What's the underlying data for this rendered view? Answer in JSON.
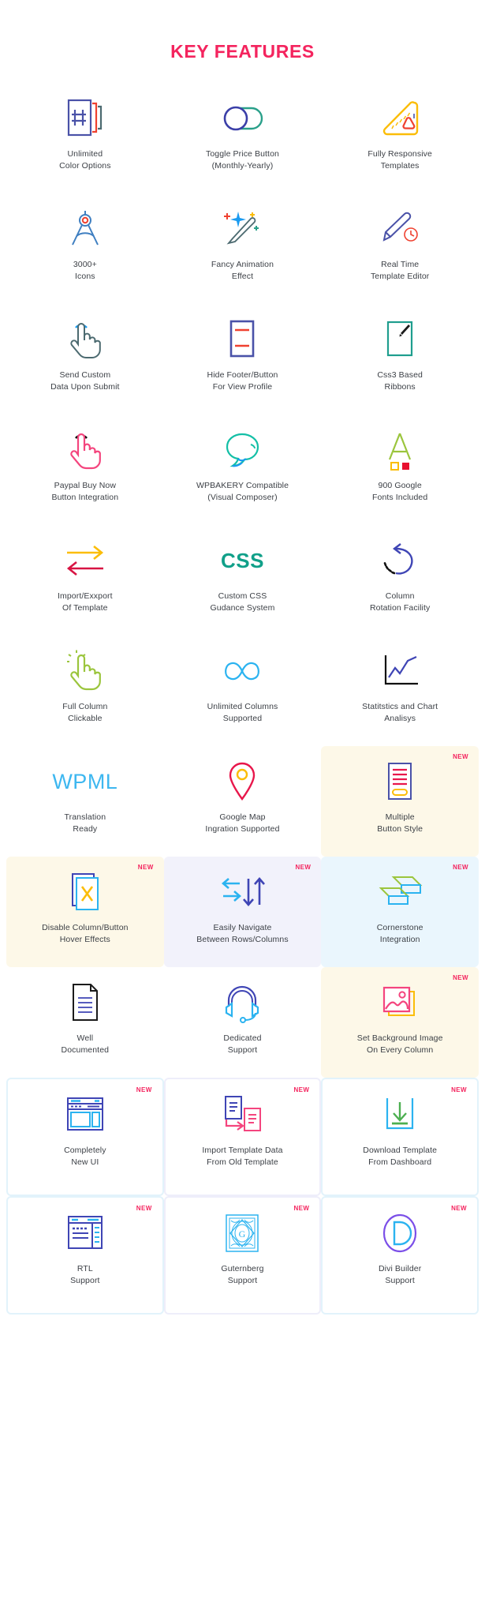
{
  "header": {
    "title": "KEY FEATURES",
    "title_color": "#f4245e"
  },
  "badges": {
    "new": "NEW",
    "new_color": "#f4245e"
  },
  "features": [
    {
      "id": "unlimited-color-options",
      "label": "Unlimited\nColor Options",
      "icon": "color-swatch-hash-icon",
      "badge": null,
      "bg": "none"
    },
    {
      "id": "toggle-price-button",
      "label": "Toggle Price Button\n(Monthly-Yearly)",
      "icon": "toggle-switch-icon",
      "badge": null,
      "bg": "none"
    },
    {
      "id": "fully-responsive-templates",
      "label": "Fully Responsive\nTemplates",
      "icon": "ruler-triangle-icon",
      "badge": null,
      "bg": "none"
    },
    {
      "id": "3000-icons",
      "label": "3000+\nIcons",
      "icon": "compass-divider-icon",
      "badge": null,
      "bg": "none"
    },
    {
      "id": "fancy-animation-effect",
      "label": "Fancy Animation\nEffect",
      "icon": "magic-wand-sparkle-icon",
      "badge": null,
      "bg": "none"
    },
    {
      "id": "real-time-template-editor",
      "label": "Real Time\nTemplate Editor",
      "icon": "pencil-clock-icon",
      "badge": null,
      "bg": "none"
    },
    {
      "id": "send-custom-data",
      "label": "Send  Custom\nData Upon Submit",
      "icon": "click-hand-icon",
      "badge": null,
      "bg": "none"
    },
    {
      "id": "hide-footer-button",
      "label": "Hide Footer/Button\nFor View Profile",
      "icon": "document-lines-icon",
      "badge": null,
      "bg": "none"
    },
    {
      "id": "css3-based-ribbons",
      "label": "Css3 Based\nRibbons",
      "icon": "ribbon-page-icon",
      "badge": null,
      "bg": "none"
    },
    {
      "id": "paypal-buy-now",
      "label": "Paypal Buy Now\nButton Integration",
      "icon": "pink-click-hand-icon",
      "badge": null,
      "bg": "none"
    },
    {
      "id": "wpbakery-compatible",
      "label": "WPBAKERY Compatible\n(Visual Composer)",
      "icon": "wpbakery-cloud-icon",
      "badge": null,
      "bg": "none"
    },
    {
      "id": "900-google-fonts",
      "label": "900 Google\nFonts Included",
      "icon": "letter-a-fonts-icon",
      "badge": null,
      "bg": "none"
    },
    {
      "id": "import-export-template",
      "label": "Import/Exxport\nOf Template",
      "icon": "two-arrows-icon",
      "badge": null,
      "bg": "none"
    },
    {
      "id": "custom-css-guidance",
      "label": "Custom CSS\nGudance System",
      "icon": "css-text-icon",
      "badge": null,
      "bg": "none"
    },
    {
      "id": "column-rotation-facility",
      "label": "Column\nRotation Facility",
      "icon": "rotate-arrow-icon",
      "badge": null,
      "bg": "none"
    },
    {
      "id": "full-column-clickable",
      "label": "Full Column\nClickable",
      "icon": "green-click-hand-icon",
      "badge": null,
      "bg": "none"
    },
    {
      "id": "unlimited-columns",
      "label": "Unlimited Columns\nSupported",
      "icon": "infinity-icon",
      "badge": null,
      "bg": "none"
    },
    {
      "id": "statistics-chart-analysis",
      "label": "Statitstics and Chart\nAnalisys",
      "icon": "line-chart-icon",
      "badge": null,
      "bg": "none"
    },
    {
      "id": "translation-ready",
      "label": "Translation\nReady",
      "icon": "wpml-logo-icon",
      "badge": null,
      "bg": "none"
    },
    {
      "id": "google-map-integration",
      "label": "Google Map\nIngration Supported",
      "icon": "map-pin-icon",
      "badge": null,
      "bg": "none"
    },
    {
      "id": "multiple-button-style",
      "label": "Multiple\nButton Style",
      "icon": "button-style-list-icon",
      "badge": "NEW",
      "bg": "cream"
    },
    {
      "id": "disable-hover-effects",
      "label": "Disable Column/Button\nHover Effects",
      "icon": "disable-x-card-icon",
      "badge": "NEW",
      "bg": "cream"
    },
    {
      "id": "easily-navigate",
      "label": "Easily Navigate\nBetween Rows/Columns",
      "icon": "navigate-arrows-icon",
      "badge": "NEW",
      "bg": "lav"
    },
    {
      "id": "cornerstone-integration",
      "label": "Cornerstone\nIntegration",
      "icon": "cornerstone-blocks-icon",
      "badge": "NEW",
      "bg": "sky"
    },
    {
      "id": "well-documented",
      "label": "Well\nDocumented",
      "icon": "documentation-page-icon",
      "badge": null,
      "bg": "none"
    },
    {
      "id": "dedicated-support",
      "label": "Dedicated\nSupport",
      "icon": "headset-icon",
      "badge": null,
      "bg": "none"
    },
    {
      "id": "set-background-image",
      "label": "Set Background Image\nOn Every Column",
      "icon": "image-stack-icon",
      "badge": "NEW",
      "bg": "cream"
    },
    {
      "id": "completely-new-ui",
      "label": "Completely\nNew UI",
      "icon": "browser-ui-icon",
      "badge": "NEW",
      "bg": "border-sky"
    },
    {
      "id": "import-template-data",
      "label": "Import Template Data\nFrom Old Template",
      "icon": "import-documents-icon",
      "badge": "NEW",
      "bg": "border-lav"
    },
    {
      "id": "download-template",
      "label": "Download Template\nFrom Dashboard",
      "icon": "download-tray-icon",
      "badge": "NEW",
      "bg": "border-sky"
    },
    {
      "id": "rtl-support",
      "label": "RTL\nSupport",
      "icon": "rtl-layout-icon",
      "badge": "NEW",
      "bg": "border-sky"
    },
    {
      "id": "gutenberg-support",
      "label": "Guternberg\nSupport",
      "icon": "gutenberg-ornament-icon",
      "badge": "NEW",
      "bg": "border-lav"
    },
    {
      "id": "divi-builder-support",
      "label": "Divi Builder\nSupport",
      "icon": "divi-d-icon",
      "badge": "NEW",
      "bg": "border-sky"
    }
  ],
  "icon_text": {
    "css": "CSS",
    "wpml": "WPML",
    "letter_a": "A",
    "letter_x": "X",
    "letter_d": "D",
    "letter_g": "G"
  },
  "colors": {
    "accent_pink": "#f4245e",
    "indigo": "#4a52a8",
    "teal": "#2aa08a",
    "yellow": "#fbbd08",
    "red": "#ef4130",
    "blue": "#1b9bf0",
    "green": "#9bc53d",
    "text": "#3b3f45"
  }
}
